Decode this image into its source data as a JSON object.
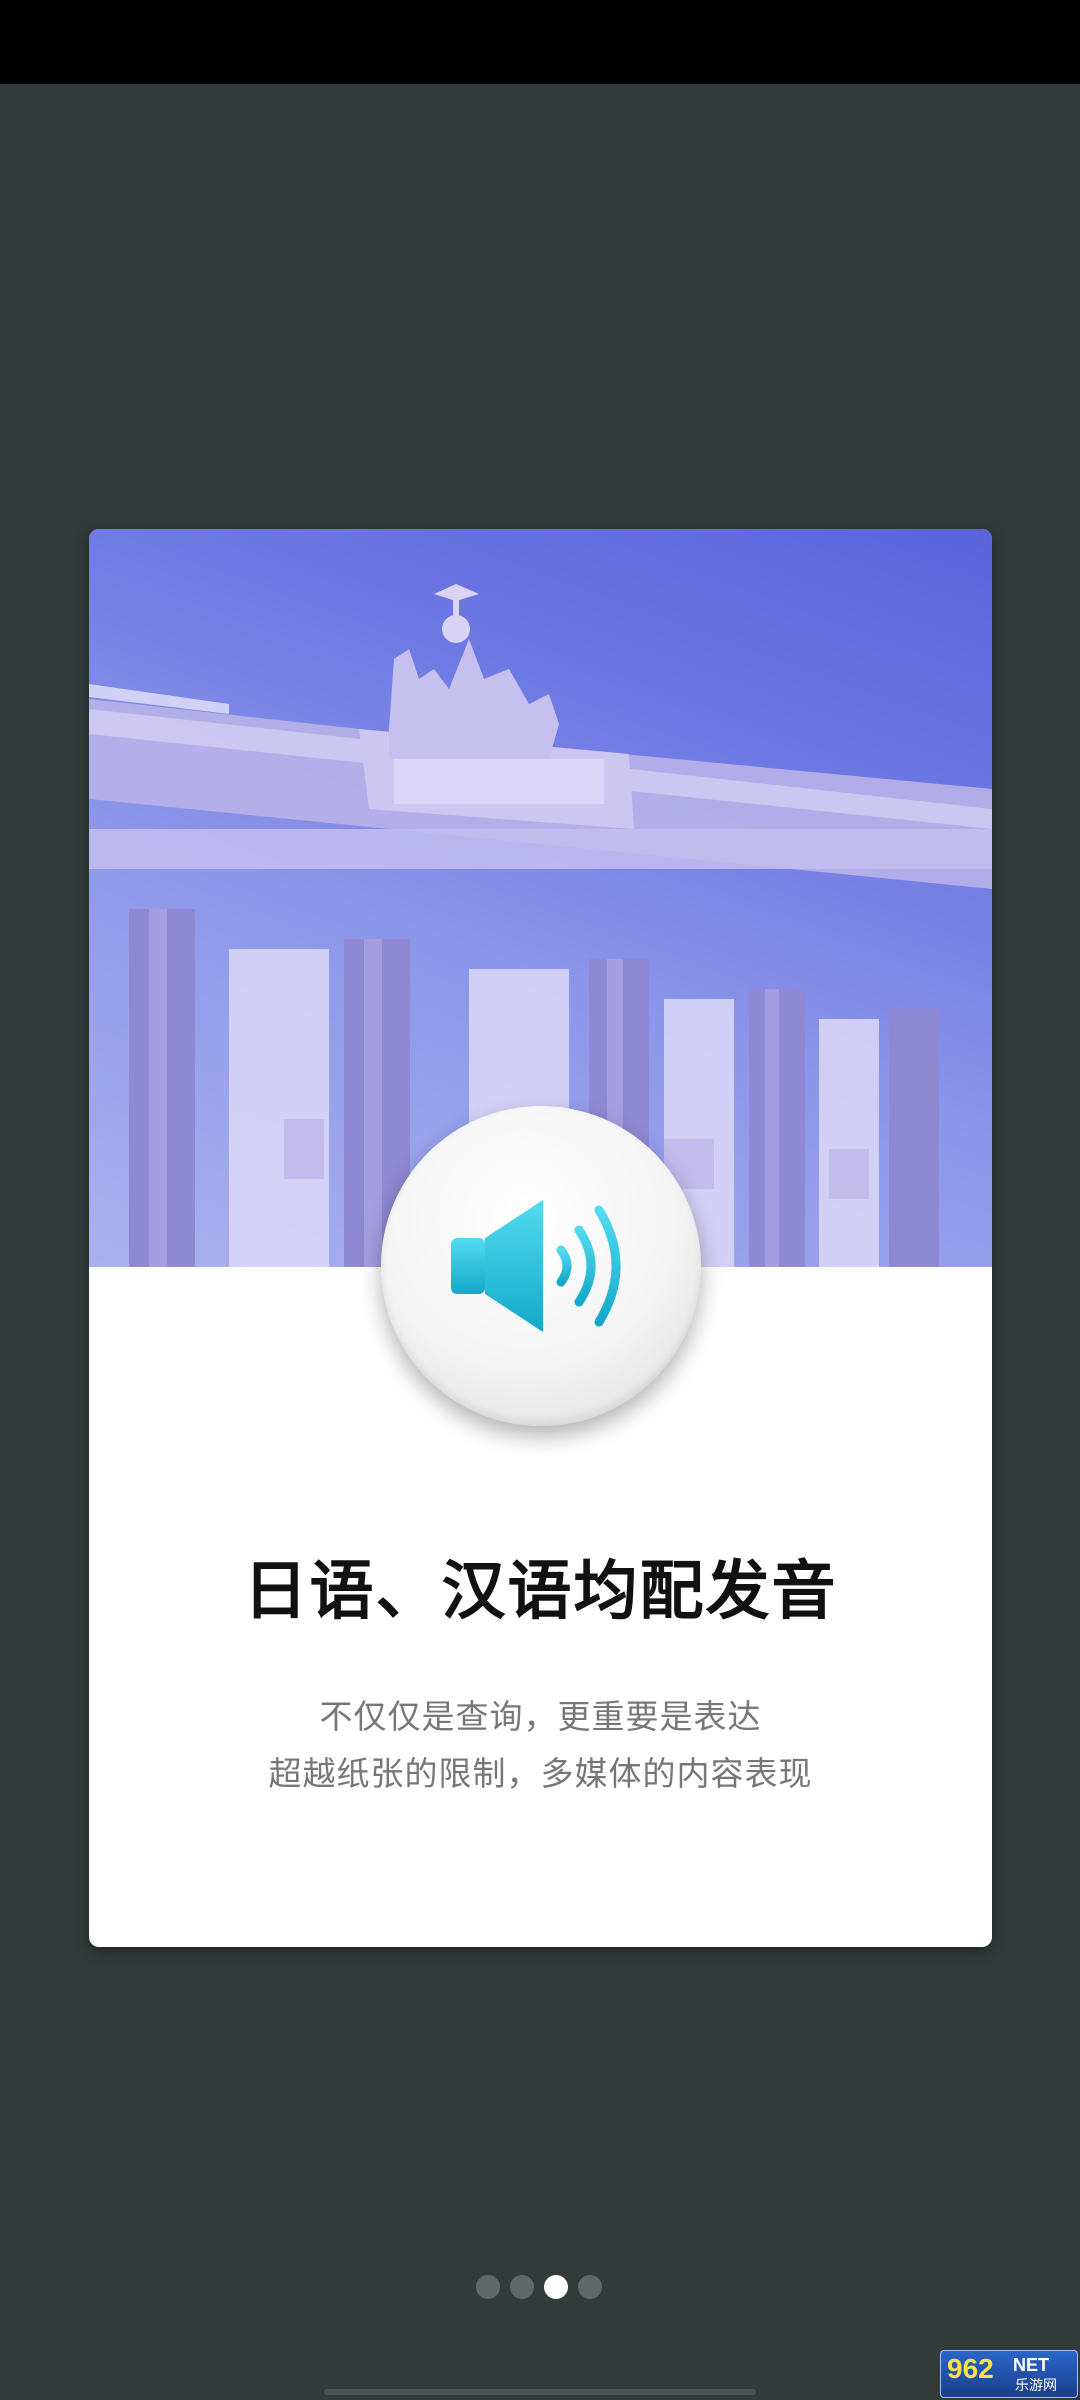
{
  "screen": {
    "title": "日语、汉语均配发音",
    "description_line1": "不仅仅是查询，更重要是表达",
    "description_line2": "超越纸张的限制，多媒体的内容表现"
  },
  "hero_image": {
    "subject": "Brandenburg Gate"
  },
  "sound_button": {
    "icon": "speaker-volume-icon",
    "accent_color": "#1fc3dc"
  },
  "pager": {
    "count": 4,
    "active_index": 2
  },
  "watermark": {
    "number": "962",
    "suffix": "NET",
    "site_name": "乐游网"
  },
  "colors": {
    "background": "#323a3a",
    "card": "#ffffff",
    "title": "#111111",
    "description": "#777777",
    "dot_inactive": "#616868",
    "dot_active": "#ffffff"
  }
}
